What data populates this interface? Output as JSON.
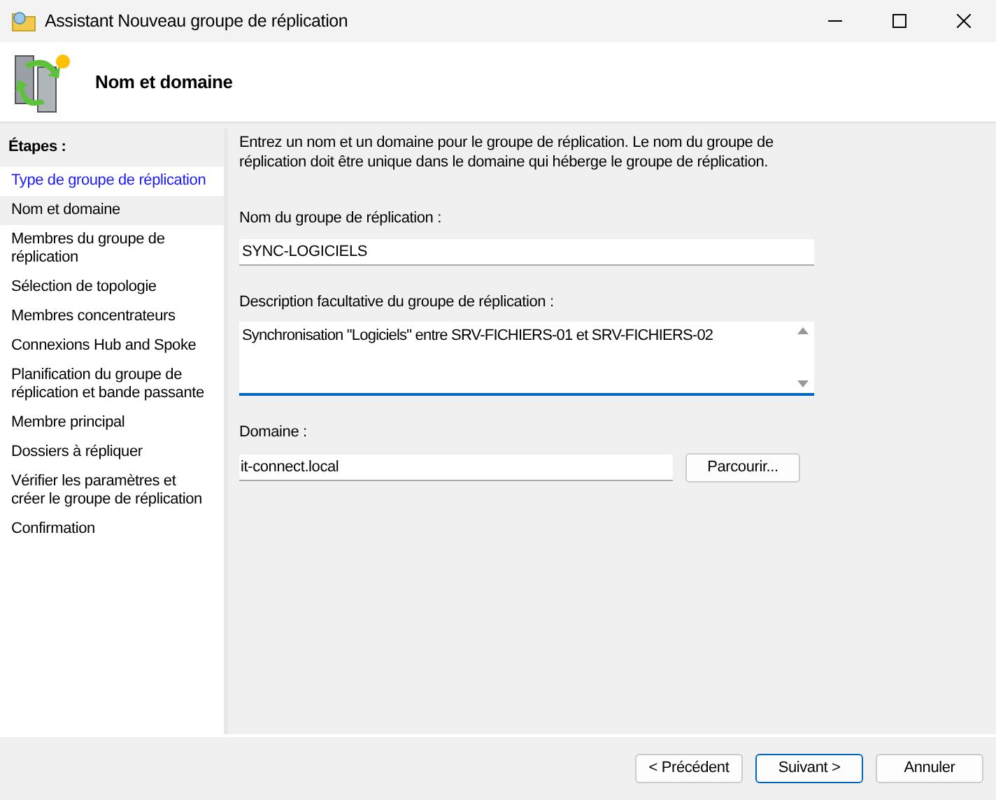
{
  "window": {
    "title": "Assistant Nouveau groupe de réplication"
  },
  "header": {
    "title": "Nom et domaine"
  },
  "steps": {
    "title": "Étapes :",
    "items": [
      {
        "label": "Type de groupe de réplication",
        "visited": true,
        "selected": false
      },
      {
        "label": "Nom et domaine",
        "visited": false,
        "selected": true
      },
      {
        "label": "Membres du groupe de réplication",
        "visited": false,
        "selected": false
      },
      {
        "label": "Sélection de topologie",
        "visited": false,
        "selected": false
      },
      {
        "label": "Membres concentrateurs",
        "visited": false,
        "selected": false
      },
      {
        "label": "Connexions Hub and Spoke",
        "visited": false,
        "selected": false
      },
      {
        "label": "Planification du groupe de réplication et bande passante",
        "visited": false,
        "selected": false
      },
      {
        "label": "Membre principal",
        "visited": false,
        "selected": false
      },
      {
        "label": "Dossiers à répliquer",
        "visited": false,
        "selected": false
      },
      {
        "label": "Vérifier les paramètres et créer le groupe de réplication",
        "visited": false,
        "selected": false
      },
      {
        "label": "Confirmation",
        "visited": false,
        "selected": false
      }
    ]
  },
  "intro": "Entrez un nom et un domaine pour le groupe de réplication. Le nom du groupe de réplication doit être unique dans le domaine qui héberge le groupe de réplication.",
  "name_field": {
    "label": "Nom du groupe de réplication :",
    "value": "SYNC-LOGICIELS"
  },
  "description_field": {
    "label": "Description facultative du groupe de réplication :",
    "value": "Synchronisation \"Logiciels\" entre SRV-FICHIERS-01 et SRV-FICHIERS-02",
    "focused": true
  },
  "domain_field": {
    "label": "Domaine :",
    "value": "it-connect.local",
    "button": "Parcourir..."
  },
  "buttons": [
    {
      "label": "< Précédent",
      "default": false
    },
    {
      "label": "Suivant >",
      "default": true
    },
    {
      "label": "Annuler",
      "default": false
    }
  ]
}
